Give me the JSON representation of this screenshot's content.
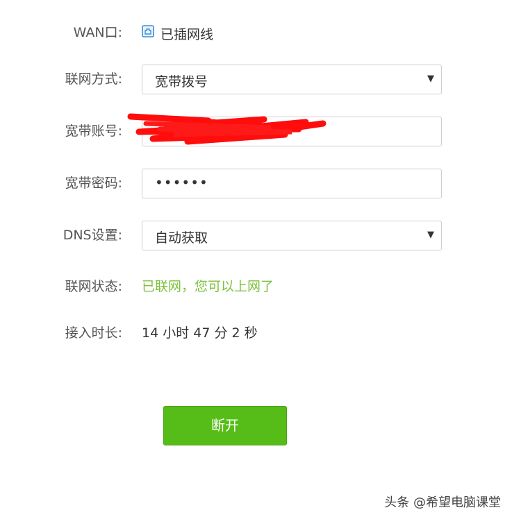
{
  "form": {
    "wan": {
      "label": "WAN口:",
      "icon": "ethernet-port-icon",
      "status": "已插网线"
    },
    "connection_type": {
      "label": "联网方式:",
      "value": "宽带拨号"
    },
    "account": {
      "label": "宽带账号:"
    },
    "password": {
      "label": "宽带密码:",
      "value": "••••••"
    },
    "dns": {
      "label": "DNS设置:",
      "value": "自动获取"
    },
    "net_status": {
      "label": "联网状态:",
      "value": "已联网，您可以上网了"
    },
    "uptime": {
      "label": "接入时长:",
      "value": "14 小时 47 分 2 秒"
    }
  },
  "disconnect_button": {
    "label": "断开"
  },
  "watermark": "头条 @希望电脑课堂",
  "colors": {
    "accent_green": "#56bd18",
    "status_green": "#7cc13e",
    "redaction_red": "#ff0000"
  }
}
